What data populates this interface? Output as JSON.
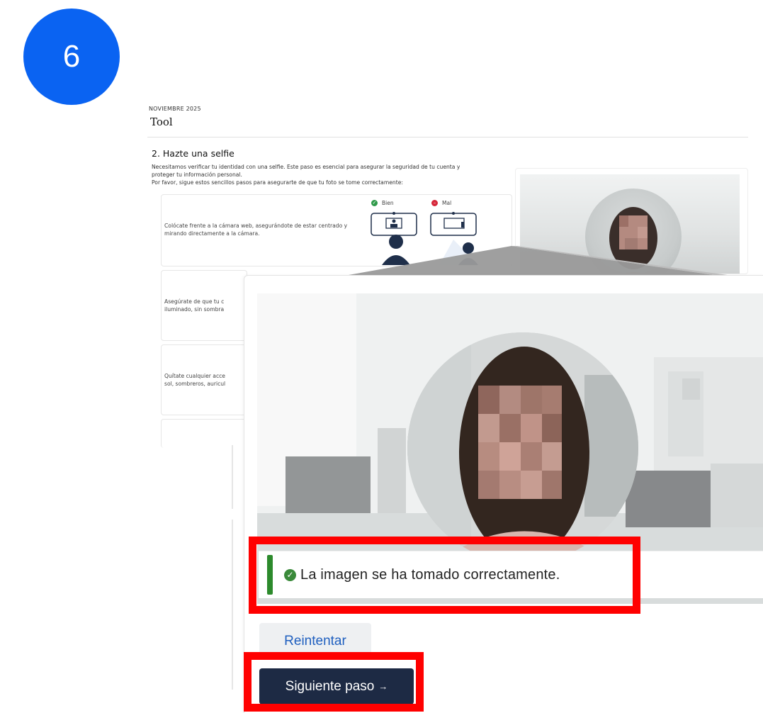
{
  "step": {
    "number": "6",
    "color": "#0a63f2"
  },
  "header": {
    "date": "NOVIEMBRE 2025",
    "title": "Tool"
  },
  "selfie": {
    "title": "2. Hazte una selfie",
    "intro": [
      "Necesitamos verificar tu identidad con una selfie. Este paso es esencial para asegurar la seguridad de tu cuenta y",
      "proteger tu información personal.",
      "Por favor, sigue estos sencillos pasos para asegurarte de que tu foto se tome correctamente:"
    ],
    "legend": {
      "good": "Bien",
      "bad": "Mal"
    },
    "tips": [
      "Colócate frente a la cámara web, asegurándote de estar centrado y mirando directamente a la cámara.",
      "Asegúrate de que tu c",
      "iluminado, sin sombra",
      "Quítate cualquier acce",
      "sol, sombreros, auricul"
    ]
  },
  "result": {
    "success_message": "La imagen se ha tomado correctamente.",
    "retry_label": "Reintentar",
    "next_label": "Siguiente paso",
    "next_arrow": "→"
  },
  "colors": {
    "highlight": "#ff0000",
    "success": "#2c8a2c",
    "primary_button": "#1d2a44",
    "link": "#1f5fbf"
  }
}
